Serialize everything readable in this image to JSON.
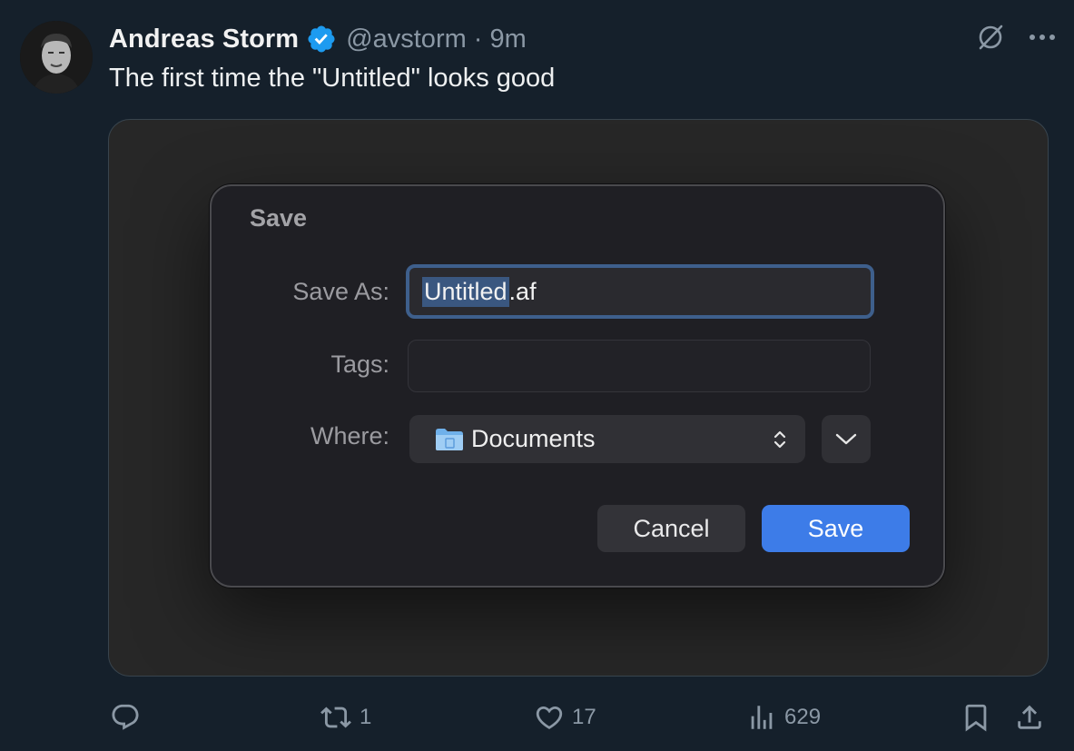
{
  "post": {
    "author_name": "Andreas Storm",
    "handle_time": "@avstorm · 9m",
    "text": "The first time the \"Untitled\" looks good"
  },
  "dialog": {
    "title": "Save",
    "save_as_label": "Save As:",
    "filename_selected": "Untitled",
    "filename_extension": ".af",
    "tags_label": "Tags:",
    "where_label": "Where:",
    "where_value": "Documents",
    "cancel_label": "Cancel",
    "save_label": "Save"
  },
  "actions": {
    "reply_count": "",
    "retweet_count": "1",
    "like_count": "17",
    "views_count": "629"
  },
  "colors": {
    "background": "#15202b",
    "accent_blue": "#3d7ce8",
    "verified_blue": "#1d9bf0",
    "muted_text": "#8b98a5"
  },
  "icons": [
    "verified-badge-icon",
    "grok-icon",
    "more-icon",
    "folder-icon",
    "updown-chevron-icon",
    "chevron-down-icon",
    "reply-icon",
    "retweet-icon",
    "like-icon",
    "views-icon",
    "bookmark-icon",
    "share-icon"
  ]
}
